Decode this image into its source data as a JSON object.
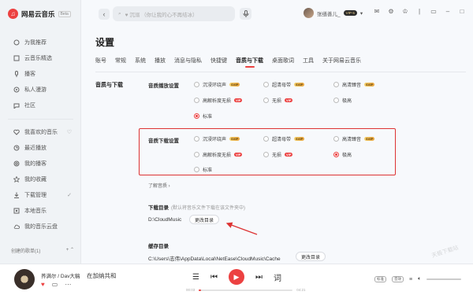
{
  "app": {
    "name": "网易云音乐",
    "beta": "Beta"
  },
  "sidebar": {
    "items": [
      {
        "label": "为我推荐",
        "icon": "recommend-icon"
      },
      {
        "label": "云音乐精选",
        "icon": "featured-icon"
      },
      {
        "label": "播客",
        "icon": "podcast-icon"
      },
      {
        "label": "私人漫游",
        "icon": "roam-icon"
      },
      {
        "label": "社区",
        "icon": "community-icon"
      }
    ],
    "items2": [
      {
        "label": "我喜欢的音乐",
        "icon": "heart-icon",
        "extra": "♡"
      },
      {
        "label": "最近播放",
        "icon": "history-icon"
      },
      {
        "label": "我的播客",
        "icon": "mypodcast-icon"
      },
      {
        "label": "我的收藏",
        "icon": "star-icon"
      },
      {
        "label": "下载管理",
        "icon": "download-icon",
        "extra": "✓"
      },
      {
        "label": "本地音乐",
        "icon": "local-icon"
      },
      {
        "label": "我的音乐云盘",
        "icon": "cloud-icon"
      }
    ],
    "footer": {
      "label": "创建的歌单(1)",
      "icons": "+  ⌃"
    }
  },
  "topbar": {
    "search_placeholder": "♥ 沉溺 （你让我的心不再结冰）",
    "username": "张缮善儿_",
    "vip": "VIP·5"
  },
  "page": {
    "title": "设置",
    "tabs": [
      "账号",
      "常规",
      "系统",
      "播放",
      "消息与隐私",
      "快捷键",
      "音质与下载",
      "桌面歌词",
      "工具",
      "关于网易云音乐"
    ],
    "active_tab": "音质与下载",
    "section": "音质与下载",
    "play_quality": {
      "title": "音质播放设置",
      "options": [
        {
          "label": "沉浸环绕声",
          "badge": "SVIP"
        },
        {
          "label": "超清母带",
          "badge": "SVIP"
        },
        {
          "label": "高清臻音",
          "badge": "SVIP"
        },
        {
          "label": "高解析度无损",
          "badge": "VIP"
        },
        {
          "label": "无损",
          "badge": "VIP"
        },
        {
          "label": "极高",
          "badge": ""
        },
        {
          "label": "标准",
          "badge": ""
        }
      ],
      "selected": "标准"
    },
    "download_quality": {
      "title": "音质下载设置",
      "options": [
        {
          "label": "沉浸环绕声",
          "badge": "SVIP"
        },
        {
          "label": "超清母带",
          "badge": "SVIP"
        },
        {
          "label": "高清臻音",
          "badge": "SVIP"
        },
        {
          "label": "高解析度无损",
          "badge": "VIP"
        },
        {
          "label": "无损",
          "badge": "VIP"
        },
        {
          "label": "极高",
          "badge": ""
        },
        {
          "label": "标准",
          "badge": ""
        }
      ],
      "selected": "极高"
    },
    "learn_more": "了解音质 ›",
    "download_dir": {
      "label": "下载目录",
      "hint": "(默认将音乐文件下载在该文件夹中)",
      "path": "D:\\CloudMusic",
      "button": "更改目录"
    },
    "cache_dir": {
      "label": "缓存目录",
      "path": "C:\\Users\\志伟\\AppData\\Local\\NetEase\\CloudMusic\\Cache",
      "button": "更改目录"
    },
    "watermark": "天极下载站"
  },
  "player": {
    "song": "荞满尔 / Dav大稿",
    "lyric": "在加纳共和",
    "time_current": "00:03",
    "time_total": "04:21",
    "progress": 0.02,
    "quality_badge": "标准",
    "effect_badge": "音效"
  },
  "colors": {
    "accent": "#ec4141",
    "highlight_border": "#d33"
  }
}
